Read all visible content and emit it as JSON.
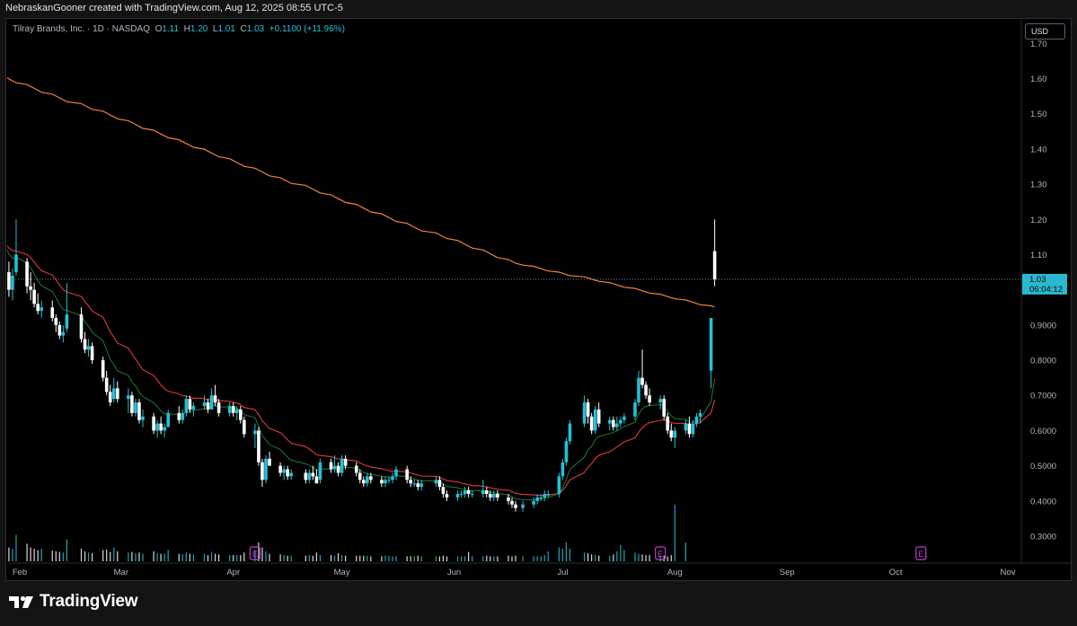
{
  "header": {
    "credit": "NebraskanGooner created with TradingView.com, Aug 12, 2025 08:55 UTC-5"
  },
  "legend": {
    "symbol": "Tilray Brands, Inc. · 1D · NASDAQ",
    "open_label": "O",
    "open": "1.11",
    "high_label": "H",
    "high": "1.20",
    "low_label": "L",
    "low": "1.01",
    "close_label": "C",
    "close": "1.03",
    "change": "+0.1100 (+11.96%)"
  },
  "currency_button": "USD",
  "price_tag": {
    "price": "1.03",
    "countdown": "06:04:12"
  },
  "footer": {
    "brand": "TradingView"
  },
  "colors": {
    "up": "#22c1d6",
    "down": "#ffffff",
    "sma200": "#f0843c",
    "ema_red": "#e03a3a",
    "ema_green": "#1f7a3a",
    "background": "#000000"
  },
  "chart_data": {
    "type": "candlestick",
    "yaxis_ticks": [
      "0.3000",
      "0.4000",
      "0.5000",
      "0.6000",
      "0.7000",
      "0.8000",
      "0.9000",
      "1.00",
      "1.10",
      "1.20",
      "1.30",
      "1.40",
      "1.50",
      "1.60",
      "1.70"
    ],
    "xaxis_ticks": [
      {
        "label": "Feb",
        "date": "2025-02-01"
      },
      {
        "label": "Mar",
        "date": "2025-03-01"
      },
      {
        "label": "Apr",
        "date": "2025-04-01"
      },
      {
        "label": "May",
        "date": "2025-05-01"
      },
      {
        "label": "Jun",
        "date": "2025-06-01"
      },
      {
        "label": "Jul",
        "date": "2025-07-01"
      },
      {
        "label": "Aug",
        "date": "2025-08-01"
      },
      {
        "label": "Sep",
        "date": "2025-09-01"
      },
      {
        "label": "Oct",
        "date": "2025-10-01"
      },
      {
        "label": "Nov",
        "date": "2025-11-01"
      }
    ],
    "last_price": 1.03,
    "earnings_markers": [
      "2025-04-07",
      "2025-07-28",
      "2025-10-08"
    ],
    "candles": [
      [
        "2025-01-27",
        1.06,
        1.16,
        1.04,
        1.14
      ],
      [
        "2025-01-28",
        1.14,
        1.15,
        1.03,
        1.05
      ],
      [
        "2025-01-29",
        1.05,
        1.08,
        0.98,
        1.0
      ],
      [
        "2025-01-30",
        1.0,
        1.06,
        0.97,
        1.04
      ],
      [
        "2025-01-31",
        1.05,
        1.2,
        1.04,
        1.1
      ],
      [
        "2025-02-03",
        1.08,
        1.09,
        0.99,
        1.01
      ],
      [
        "2025-02-04",
        1.01,
        1.05,
        0.97,
        1.0
      ],
      [
        "2025-02-05",
        1.0,
        1.02,
        0.95,
        0.96
      ],
      [
        "2025-02-06",
        0.96,
        0.99,
        0.93,
        0.94
      ],
      [
        "2025-02-07",
        0.94,
        0.97,
        0.92,
        0.95
      ],
      [
        "2025-02-10",
        0.95,
        0.97,
        0.91,
        0.92
      ],
      [
        "2025-02-11",
        0.92,
        0.93,
        0.88,
        0.9
      ],
      [
        "2025-02-12",
        0.9,
        0.91,
        0.86,
        0.87
      ],
      [
        "2025-02-13",
        0.87,
        0.9,
        0.85,
        0.88
      ],
      [
        "2025-02-14",
        0.89,
        1.02,
        0.88,
        0.93
      ],
      [
        "2025-02-18",
        0.93,
        0.95,
        0.85,
        0.86
      ],
      [
        "2025-02-19",
        0.86,
        0.88,
        0.82,
        0.83
      ],
      [
        "2025-02-20",
        0.83,
        0.86,
        0.81,
        0.84
      ],
      [
        "2025-02-21",
        0.84,
        0.85,
        0.79,
        0.8
      ],
      [
        "2025-02-24",
        0.8,
        0.81,
        0.74,
        0.75
      ],
      [
        "2025-02-25",
        0.75,
        0.77,
        0.7,
        0.71
      ],
      [
        "2025-02-26",
        0.71,
        0.73,
        0.67,
        0.68
      ],
      [
        "2025-02-27",
        0.69,
        0.75,
        0.68,
        0.72
      ],
      [
        "2025-02-28",
        0.72,
        0.74,
        0.68,
        0.69
      ],
      [
        "2025-03-03",
        0.69,
        0.72,
        0.65,
        0.7
      ],
      [
        "2025-03-04",
        0.7,
        0.71,
        0.64,
        0.65
      ],
      [
        "2025-03-05",
        0.65,
        0.69,
        0.64,
        0.68
      ],
      [
        "2025-03-06",
        0.68,
        0.69,
        0.62,
        0.63
      ],
      [
        "2025-03-07",
        0.63,
        0.66,
        0.61,
        0.64
      ],
      [
        "2025-03-10",
        0.64,
        0.65,
        0.59,
        0.6
      ],
      [
        "2025-03-11",
        0.6,
        0.63,
        0.58,
        0.62
      ],
      [
        "2025-03-12",
        0.62,
        0.64,
        0.59,
        0.6
      ],
      [
        "2025-03-13",
        0.6,
        0.62,
        0.58,
        0.61
      ],
      [
        "2025-03-14",
        0.61,
        0.66,
        0.61,
        0.65
      ],
      [
        "2025-03-17",
        0.65,
        0.67,
        0.62,
        0.63
      ],
      [
        "2025-03-18",
        0.63,
        0.66,
        0.62,
        0.65
      ],
      [
        "2025-03-19",
        0.65,
        0.7,
        0.64,
        0.69
      ],
      [
        "2025-03-20",
        0.69,
        0.7,
        0.65,
        0.66
      ],
      [
        "2025-03-21",
        0.66,
        0.68,
        0.64,
        0.67
      ],
      [
        "2025-03-24",
        0.67,
        0.7,
        0.66,
        0.68
      ],
      [
        "2025-03-25",
        0.68,
        0.69,
        0.65,
        0.66
      ],
      [
        "2025-03-26",
        0.66,
        0.72,
        0.66,
        0.7
      ],
      [
        "2025-03-27",
        0.7,
        0.73,
        0.67,
        0.68
      ],
      [
        "2025-03-28",
        0.68,
        0.69,
        0.64,
        0.65
      ],
      [
        "2025-03-31",
        0.65,
        0.68,
        0.64,
        0.67
      ],
      [
        "2025-04-01",
        0.67,
        0.68,
        0.64,
        0.65
      ],
      [
        "2025-04-02",
        0.65,
        0.67,
        0.63,
        0.66
      ],
      [
        "2025-04-03",
        0.66,
        0.67,
        0.62,
        0.63
      ],
      [
        "2025-04-04",
        0.63,
        0.64,
        0.58,
        0.59
      ],
      [
        "2025-04-07",
        0.59,
        0.62,
        0.55,
        0.6
      ],
      [
        "2025-04-08",
        0.6,
        0.61,
        0.5,
        0.51
      ],
      [
        "2025-04-09",
        0.51,
        0.52,
        0.44,
        0.46
      ],
      [
        "2025-04-10",
        0.46,
        0.53,
        0.45,
        0.52
      ],
      [
        "2025-04-11",
        0.52,
        0.54,
        0.5,
        0.5
      ],
      [
        "2025-04-14",
        0.5,
        0.51,
        0.47,
        0.48
      ],
      [
        "2025-04-15",
        0.48,
        0.5,
        0.46,
        0.49
      ],
      [
        "2025-04-16",
        0.49,
        0.5,
        0.46,
        0.47
      ],
      [
        "2025-04-17",
        0.47,
        0.49,
        0.46,
        0.48
      ],
      [
        "2025-04-21",
        0.48,
        0.49,
        0.45,
        0.46
      ],
      [
        "2025-04-22",
        0.46,
        0.49,
        0.45,
        0.48
      ],
      [
        "2025-04-23",
        0.48,
        0.5,
        0.46,
        0.47
      ],
      [
        "2025-04-24",
        0.47,
        0.49,
        0.45,
        0.45
      ],
      [
        "2025-04-25",
        0.46,
        0.52,
        0.45,
        0.51
      ],
      [
        "2025-04-28",
        0.51,
        0.52,
        0.48,
        0.49
      ],
      [
        "2025-04-29",
        0.49,
        0.53,
        0.48,
        0.5
      ],
      [
        "2025-04-30",
        0.5,
        0.51,
        0.47,
        0.48
      ],
      [
        "2025-05-01",
        0.48,
        0.53,
        0.47,
        0.52
      ],
      [
        "2025-05-02",
        0.52,
        0.53,
        0.49,
        0.5
      ],
      [
        "2025-05-05",
        0.5,
        0.51,
        0.47,
        0.48
      ],
      [
        "2025-05-06",
        0.48,
        0.49,
        0.45,
        0.46
      ],
      [
        "2025-05-07",
        0.46,
        0.47,
        0.44,
        0.45
      ],
      [
        "2025-05-08",
        0.45,
        0.48,
        0.44,
        0.47
      ],
      [
        "2025-05-09",
        0.47,
        0.48,
        0.45,
        0.46
      ],
      [
        "2025-05-12",
        0.46,
        0.47,
        0.44,
        0.45
      ],
      [
        "2025-05-13",
        0.45,
        0.47,
        0.44,
        0.46
      ],
      [
        "2025-05-14",
        0.46,
        0.47,
        0.45,
        0.46
      ],
      [
        "2025-05-15",
        0.46,
        0.48,
        0.45,
        0.47
      ],
      [
        "2025-05-16",
        0.47,
        0.5,
        0.46,
        0.49
      ],
      [
        "2025-05-19",
        0.49,
        0.5,
        0.45,
        0.46
      ],
      [
        "2025-05-20",
        0.46,
        0.47,
        0.44,
        0.45
      ],
      [
        "2025-05-21",
        0.45,
        0.46,
        0.44,
        0.45
      ],
      [
        "2025-05-22",
        0.45,
        0.46,
        0.43,
        0.44
      ],
      [
        "2025-05-23",
        0.44,
        0.46,
        0.43,
        0.45
      ],
      [
        "2025-05-27",
        0.45,
        0.47,
        0.44,
        0.46
      ],
      [
        "2025-05-28",
        0.46,
        0.47,
        0.43,
        0.44
      ],
      [
        "2025-05-29",
        0.44,
        0.45,
        0.41,
        0.42
      ],
      [
        "2025-05-30",
        0.42,
        0.43,
        0.4,
        0.41
      ],
      [
        "2025-06-02",
        0.41,
        0.43,
        0.4,
        0.42
      ],
      [
        "2025-06-03",
        0.42,
        0.43,
        0.41,
        0.42
      ],
      [
        "2025-06-04",
        0.42,
        0.44,
        0.41,
        0.43
      ],
      [
        "2025-06-05",
        0.43,
        0.44,
        0.41,
        0.42
      ],
      [
        "2025-06-06",
        0.42,
        0.43,
        0.41,
        0.42
      ],
      [
        "2025-06-09",
        0.42,
        0.46,
        0.41,
        0.43
      ],
      [
        "2025-06-10",
        0.43,
        0.44,
        0.41,
        0.42
      ],
      [
        "2025-06-11",
        0.42,
        0.43,
        0.4,
        0.41
      ],
      [
        "2025-06-12",
        0.41,
        0.43,
        0.4,
        0.42
      ],
      [
        "2025-06-13",
        0.42,
        0.43,
        0.4,
        0.41
      ],
      [
        "2025-06-16",
        0.41,
        0.42,
        0.39,
        0.4
      ],
      [
        "2025-06-17",
        0.4,
        0.41,
        0.38,
        0.39
      ],
      [
        "2025-06-18",
        0.39,
        0.4,
        0.37,
        0.38
      ],
      [
        "2025-06-20",
        0.38,
        0.4,
        0.37,
        0.39
      ],
      [
        "2025-06-23",
        0.39,
        0.41,
        0.38,
        0.4
      ],
      [
        "2025-06-24",
        0.4,
        0.42,
        0.39,
        0.41
      ],
      [
        "2025-06-25",
        0.41,
        0.42,
        0.4,
        0.41
      ],
      [
        "2025-06-26",
        0.41,
        0.43,
        0.4,
        0.42
      ],
      [
        "2025-06-27",
        0.42,
        0.43,
        0.41,
        0.42
      ],
      [
        "2025-06-30",
        0.42,
        0.48,
        0.41,
        0.47
      ],
      [
        "2025-07-01",
        0.47,
        0.52,
        0.46,
        0.51
      ],
      [
        "2025-07-02",
        0.51,
        0.58,
        0.5,
        0.57
      ],
      [
        "2025-07-03",
        0.57,
        0.63,
        0.56,
        0.62
      ],
      [
        "2025-07-07",
        0.62,
        0.7,
        0.61,
        0.68
      ],
      [
        "2025-07-08",
        0.68,
        0.69,
        0.62,
        0.64
      ],
      [
        "2025-07-09",
        0.64,
        0.65,
        0.59,
        0.6
      ],
      [
        "2025-07-10",
        0.6,
        0.67,
        0.59,
        0.66
      ],
      [
        "2025-07-11",
        0.66,
        0.68,
        0.61,
        0.62
      ],
      [
        "2025-07-14",
        0.62,
        0.64,
        0.6,
        0.63
      ],
      [
        "2025-07-15",
        0.63,
        0.64,
        0.6,
        0.61
      ],
      [
        "2025-07-16",
        0.61,
        0.64,
        0.6,
        0.62
      ],
      [
        "2025-07-17",
        0.62,
        0.64,
        0.61,
        0.63
      ],
      [
        "2025-07-18",
        0.63,
        0.65,
        0.62,
        0.64
      ],
      [
        "2025-07-21",
        0.64,
        0.69,
        0.63,
        0.68
      ],
      [
        "2025-07-22",
        0.68,
        0.77,
        0.67,
        0.75
      ],
      [
        "2025-07-23",
        0.75,
        0.83,
        0.72,
        0.73
      ],
      [
        "2025-07-24",
        0.73,
        0.74,
        0.69,
        0.7
      ],
      [
        "2025-07-25",
        0.7,
        0.72,
        0.67,
        0.68
      ],
      [
        "2025-07-28",
        0.68,
        0.7,
        0.66,
        0.69
      ],
      [
        "2025-07-29",
        0.69,
        0.7,
        0.63,
        0.64
      ],
      [
        "2025-07-30",
        0.64,
        0.65,
        0.59,
        0.6
      ],
      [
        "2025-07-31",
        0.6,
        0.62,
        0.57,
        0.58
      ],
      [
        "2025-08-01",
        0.58,
        0.61,
        0.55,
        0.6
      ],
      [
        "2025-08-04",
        0.6,
        0.63,
        0.59,
        0.62
      ],
      [
        "2025-08-05",
        0.62,
        0.64,
        0.58,
        0.59
      ],
      [
        "2025-08-06",
        0.59,
        0.63,
        0.58,
        0.62
      ],
      [
        "2025-08-07",
        0.62,
        0.65,
        0.61,
        0.64
      ],
      [
        "2025-08-08",
        0.64,
        0.66,
        0.62,
        0.65
      ],
      [
        "2025-08-11",
        0.77,
        0.92,
        0.72,
        0.92
      ],
      [
        "2025-08-12",
        1.11,
        1.2,
        1.01,
        1.03
      ]
    ],
    "volume": [
      30,
      25,
      22,
      20,
      42,
      28,
      22,
      20,
      18,
      20,
      17,
      16,
      15,
      14,
      35,
      20,
      16,
      14,
      13,
      18,
      19,
      15,
      22,
      16,
      14,
      15,
      13,
      14,
      12,
      16,
      13,
      12,
      12,
      18,
      12,
      11,
      14,
      12,
      11,
      12,
      10,
      15,
      12,
      11,
      10,
      10,
      10,
      10,
      14,
      18,
      30,
      22,
      16,
      12,
      11,
      10,
      9,
      9,
      9,
      10,
      9,
      14,
      10,
      10,
      9,
      13,
      10,
      9,
      9,
      9,
      9,
      9,
      8,
      8,
      9,
      9,
      8,
      8,
      8,
      8,
      8,
      9,
      8,
      8,
      8,
      9,
      8,
      8,
      8,
      8,
      15,
      8,
      8,
      9,
      8,
      8,
      8,
      9,
      8,
      9,
      8,
      8,
      8,
      8,
      10,
      16,
      22,
      20,
      30,
      20,
      14,
      13,
      11,
      10,
      9,
      9,
      11,
      16,
      26,
      18,
      14,
      12,
      11,
      10,
      10,
      9,
      9,
      8,
      10,
      90,
      30
    ]
  }
}
